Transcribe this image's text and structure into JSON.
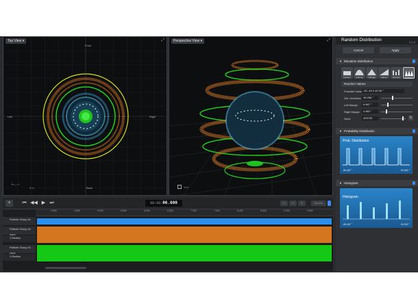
{
  "viewports": {
    "top": {
      "label": "Top View",
      "front": "Front",
      "back": "Back",
      "left": "Left",
      "right": "Right",
      "scale": "5 m"
    },
    "perspective": {
      "label": "Perspective View",
      "scale": "1 m"
    }
  },
  "transport": {
    "timecode_prefix": "00:00:",
    "timecode_main": "06.600",
    "buttons": [
      "VO",
      "VR",
      "⚙"
    ],
    "render": "Render"
  },
  "timeline": {
    "ruler": [
      "4.000",
      "4.500",
      "5.000",
      "5.500",
      "6.000",
      "6.500",
      "7.000",
      "7.500",
      "8.000",
      "8.500",
      "9.000",
      "9.500",
      "10.000"
    ],
    "tracks": [
      {
        "label": "Particle Group #1",
        "color": "#2b8ff0"
      },
      {
        "label": "Particle Group #1 copy",
        "color": "#d4761f"
      },
      {
        "label": "1.Radius",
        "color": "#d4761f"
      },
      {
        "label": "Particle Group #1 copy",
        "color": "#16c816"
      },
      {
        "label": "1.Radius",
        "color": "#16c816"
      }
    ]
  },
  "panel": {
    "title": "Random Distribution",
    "version": "2.1.0",
    "cancel": "Cancel",
    "apply": "Apply",
    "elevation": "Elevation Distribution",
    "distributions": [
      "Uniform",
      "Normal",
      "Triangle",
      "Ramp",
      "Discrete",
      "Custom"
    ],
    "dropdown": "Random Values",
    "fields": [
      {
        "label": "Possible Value",
        "value": "-90 -45 0 45 90 °"
      },
      {
        "label": "Std. Deviation",
        "value": "45.256 °"
      },
      {
        "label": "Left Margin",
        "value": "6.667 °"
      },
      {
        "label": "Right Margin",
        "value": "4.982 °"
      },
      {
        "label": "Seed",
        "value": "493730"
      }
    ],
    "probability": {
      "header": "Probability Distribution",
      "title": "Prob. Distribution",
      "min": "-96.467 °",
      "max": "94.902 °"
    },
    "histogram": {
      "header": "Histogram",
      "title": "Histogram",
      "min": "-96.467 °",
      "max": "94.902 °"
    }
  }
}
